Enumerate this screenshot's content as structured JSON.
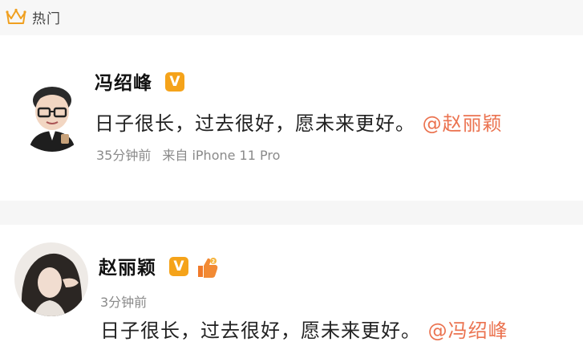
{
  "header": {
    "title": "热门",
    "icon": "crown-icon"
  },
  "posts": [
    {
      "username": "冯绍峰",
      "verified_badge": "V",
      "text": "日子很长，过去很好，愿未来更好。",
      "mention": "@赵丽颖",
      "time": "35分钟前",
      "source": "来自 iPhone 11 Pro"
    },
    {
      "username": "赵丽颖",
      "verified_badge": "V",
      "level_badge_icon": "thumbs-up-level-icon",
      "time": "3分钟前",
      "text": "日子很长，过去很好，愿未来更好。",
      "mention": "@冯绍峰"
    }
  ],
  "colors": {
    "mention": "#eb7350",
    "verified": "#f5a31a",
    "meta": "#8a8a8a"
  }
}
